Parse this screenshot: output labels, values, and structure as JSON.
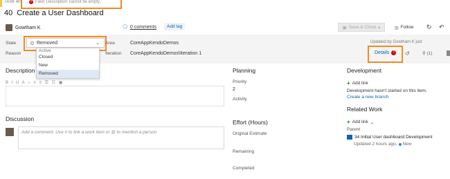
{
  "header": {
    "task_tag": "TASK 40*",
    "error_text": "Field 'Description' cannot be empty.",
    "error_icon_glyph": "!",
    "id": "40",
    "title": "Create a User Dashboard"
  },
  "owner": {
    "name": "Gowtham K"
  },
  "comments": {
    "label": "0 comments"
  },
  "add_tag_label": "Add tag",
  "toolbar": {
    "save_label": "Save & Close",
    "save_caret": "▾",
    "follow_label": "Follow",
    "refresh_glyph": "↻",
    "undo_glyph": "↶"
  },
  "fields": {
    "state_label": "State",
    "state_value": "Removed",
    "reason_label": "Reason",
    "area_label": "Area",
    "area_value": "CoreAppKendoDemos",
    "iteration_label": "Iteration",
    "iteration_value": "CoreAppKendoDemos\\Iteration 1"
  },
  "state_options": [
    "Active",
    "Closed",
    "New",
    "Removed"
  ],
  "updated_text": "Updated by Gowtham K just",
  "tabs": {
    "details_label": "Details",
    "details_badge": "!",
    "history_glyph": "↺",
    "links_label": "(1)",
    "links_glyph": "🔗"
  },
  "description": {
    "heading": "Description",
    "toolbar_text": "B  I  U  A  ⌂  ≡  ≡  ☰  ☷  ▣"
  },
  "discussion": {
    "heading": "Discussion",
    "placeholder": "Add a comment. Use # to link a work item or @ to mention a person"
  },
  "planning": {
    "heading": "Planning",
    "priority_label": "Priority",
    "priority_value": "2",
    "activity_label": "Activity"
  },
  "effort": {
    "heading": "Effort (Hours)",
    "original_label": "Original Estimate",
    "remaining_label": "Remaining",
    "completed_label": "Completed"
  },
  "development": {
    "heading": "Development",
    "add_link": "Add link",
    "note": "Development hasn't started on this item.",
    "create_branch": "Create a new branch"
  },
  "related": {
    "heading": "Related Work",
    "add_link": "Add link",
    "add_link_caret": "⌄",
    "parent_label": "Parent",
    "parent_title": "34 Initial User dashboard Development",
    "parent_meta": "Updated 2 hours ago,",
    "parent_state": "New"
  },
  "colors": {
    "accent": "#0b63b6",
    "highlight_box": "#f08a24",
    "error": "#cc0000"
  }
}
